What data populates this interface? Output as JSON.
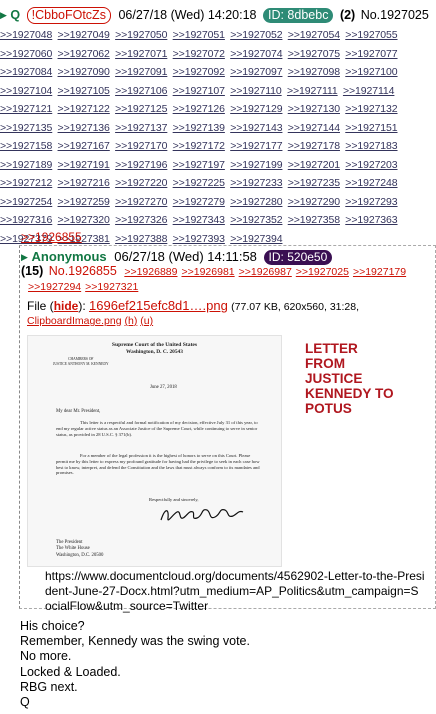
{
  "header": {
    "icon": "q-drop-arrow-icon",
    "name": "Q",
    "tripcode": "!CbboFOtcZs",
    "datetime": "06/27/18 (Wed) 14:20:18",
    "id_label": "ID: 8dbebc",
    "count": "(2)",
    "post_no": "No.1927025"
  },
  "replies": [
    [
      ">>1927048",
      ">>1927049",
      ">>1927050",
      ">>1927051",
      ">>1927052",
      ">>1927054",
      ">>1927055"
    ],
    [
      ">>1927060",
      ">>1927062",
      ">>1927071",
      ">>1927072",
      ">>1927074",
      ">>1927075",
      ">>1927077"
    ],
    [
      ">>1927084",
      ">>1927090",
      ">>1927091",
      ">>1927092",
      ">>1927097",
      ">>1927098",
      ">>1927100"
    ],
    [
      ">>1927104",
      ">>1927105",
      ">>1927106",
      ">>1927107",
      ">>1927110",
      ">>1927111",
      ">>1927114"
    ],
    [
      ">>1927121",
      ">>1927122",
      ">>1927125",
      ">>1927126",
      ">>1927129",
      ">>1927130",
      ">>1927132"
    ],
    [
      ">>1927135",
      ">>1927136",
      ">>1927137",
      ">>1927139",
      ">>1927143",
      ">>1927144",
      ">>1927151"
    ],
    [
      ">>1927158",
      ">>1927167",
      ">>1927170",
      ">>1927172",
      ">>1927177",
      ">>1927178",
      ">>1927183"
    ],
    [
      ">>1927189",
      ">>1927191",
      ">>1927196",
      ">>1927197",
      ">>1927199",
      ">>1927201",
      ">>1927203"
    ],
    [
      ">>1927212",
      ">>1927216",
      ">>1927220",
      ">>1927225",
      ">>1927233",
      ">>1927235",
      ">>1927248"
    ],
    [
      ">>1927254",
      ">>1927259",
      ">>1927270",
      ">>1927279",
      ">>1927280",
      ">>1927290",
      ">>1927293"
    ],
    [
      ">>1927316",
      ">>1927320",
      ">>1927326",
      ">>1927343",
      ">>1927352",
      ">>1927358",
      ">>1927363"
    ],
    [
      ">>1927379",
      ">>1927381",
      ">>1927388",
      ">>1927393",
      ">>1927394"
    ]
  ],
  "quoted": {
    "link": ">>1926855",
    "name": "Anonymous",
    "datetime": "06/27/18 (Wed) 14:11:58",
    "id_label": "ID: 520e50",
    "count": "(15)",
    "post_no": "No.1926855",
    "replies_row1": [
      ">>1926889",
      ">>1926981",
      ">>1926987",
      ">>1927025",
      ">>1927179"
    ],
    "replies_row2": [
      ">>1927294",
      ">>1927321"
    ],
    "file": {
      "label": "File",
      "hide": "hide",
      "filename": "1696ef215efc8d1….png",
      "meta": "(77.07 KB, 620x560, 31:28,",
      "orig": "ClipboardImage.png",
      "h": "(h)",
      "u": "(u)"
    },
    "letter": {
      "head1": "Supreme Court of the United States",
      "head2": "Washington, D. C. 20543",
      "chambers": "CHAMBERS OF\nJUSTICE ANTHONY M. KENNEDY",
      "date": "June 27, 2018",
      "salutation": "My dear Mr. President,",
      "para1": "This letter is a respectful and formal notification of my decision, effective July 31 of this year, to end my regular active status as an Associate Justice of the Supreme Court, while continuing to serve in senior status, as provided in 28 U.S.C. § 371(b).",
      "para2": "For a member of the legal profession it is the highest of honors to serve on this Court. Please permit me by this letter to express my profound gratitude for having had the privilege to seek in each case how best to know, interpret, and defend the Constitution and the laws that must always conform to its mandates and promises.",
      "closing": "Respectfully and sincerely,",
      "to": "The President\nThe White House\nWashington, D.C. 20500"
    },
    "red_caption": [
      "LETTER",
      "FROM",
      "JUSTICE",
      "KENNEDY TO",
      "POTUS"
    ],
    "url": "https://www.documentcloud.org/documents/4562902-Letter-to-the-President-June-27-Docx.html?utm_medium=AP_Politics&utm_campaign=SocialFlow&utm_source=Twitter"
  },
  "body_lines": [
    "His choice?",
    "Remember, Kennedy was the swing vote.",
    "No more.",
    "Locked & Loaded.",
    "RBG next.",
    "Q"
  ],
  "colors": {
    "name": "#117743",
    "link": "#34345c",
    "red": "#cc1105",
    "caption": "#b0171f"
  }
}
